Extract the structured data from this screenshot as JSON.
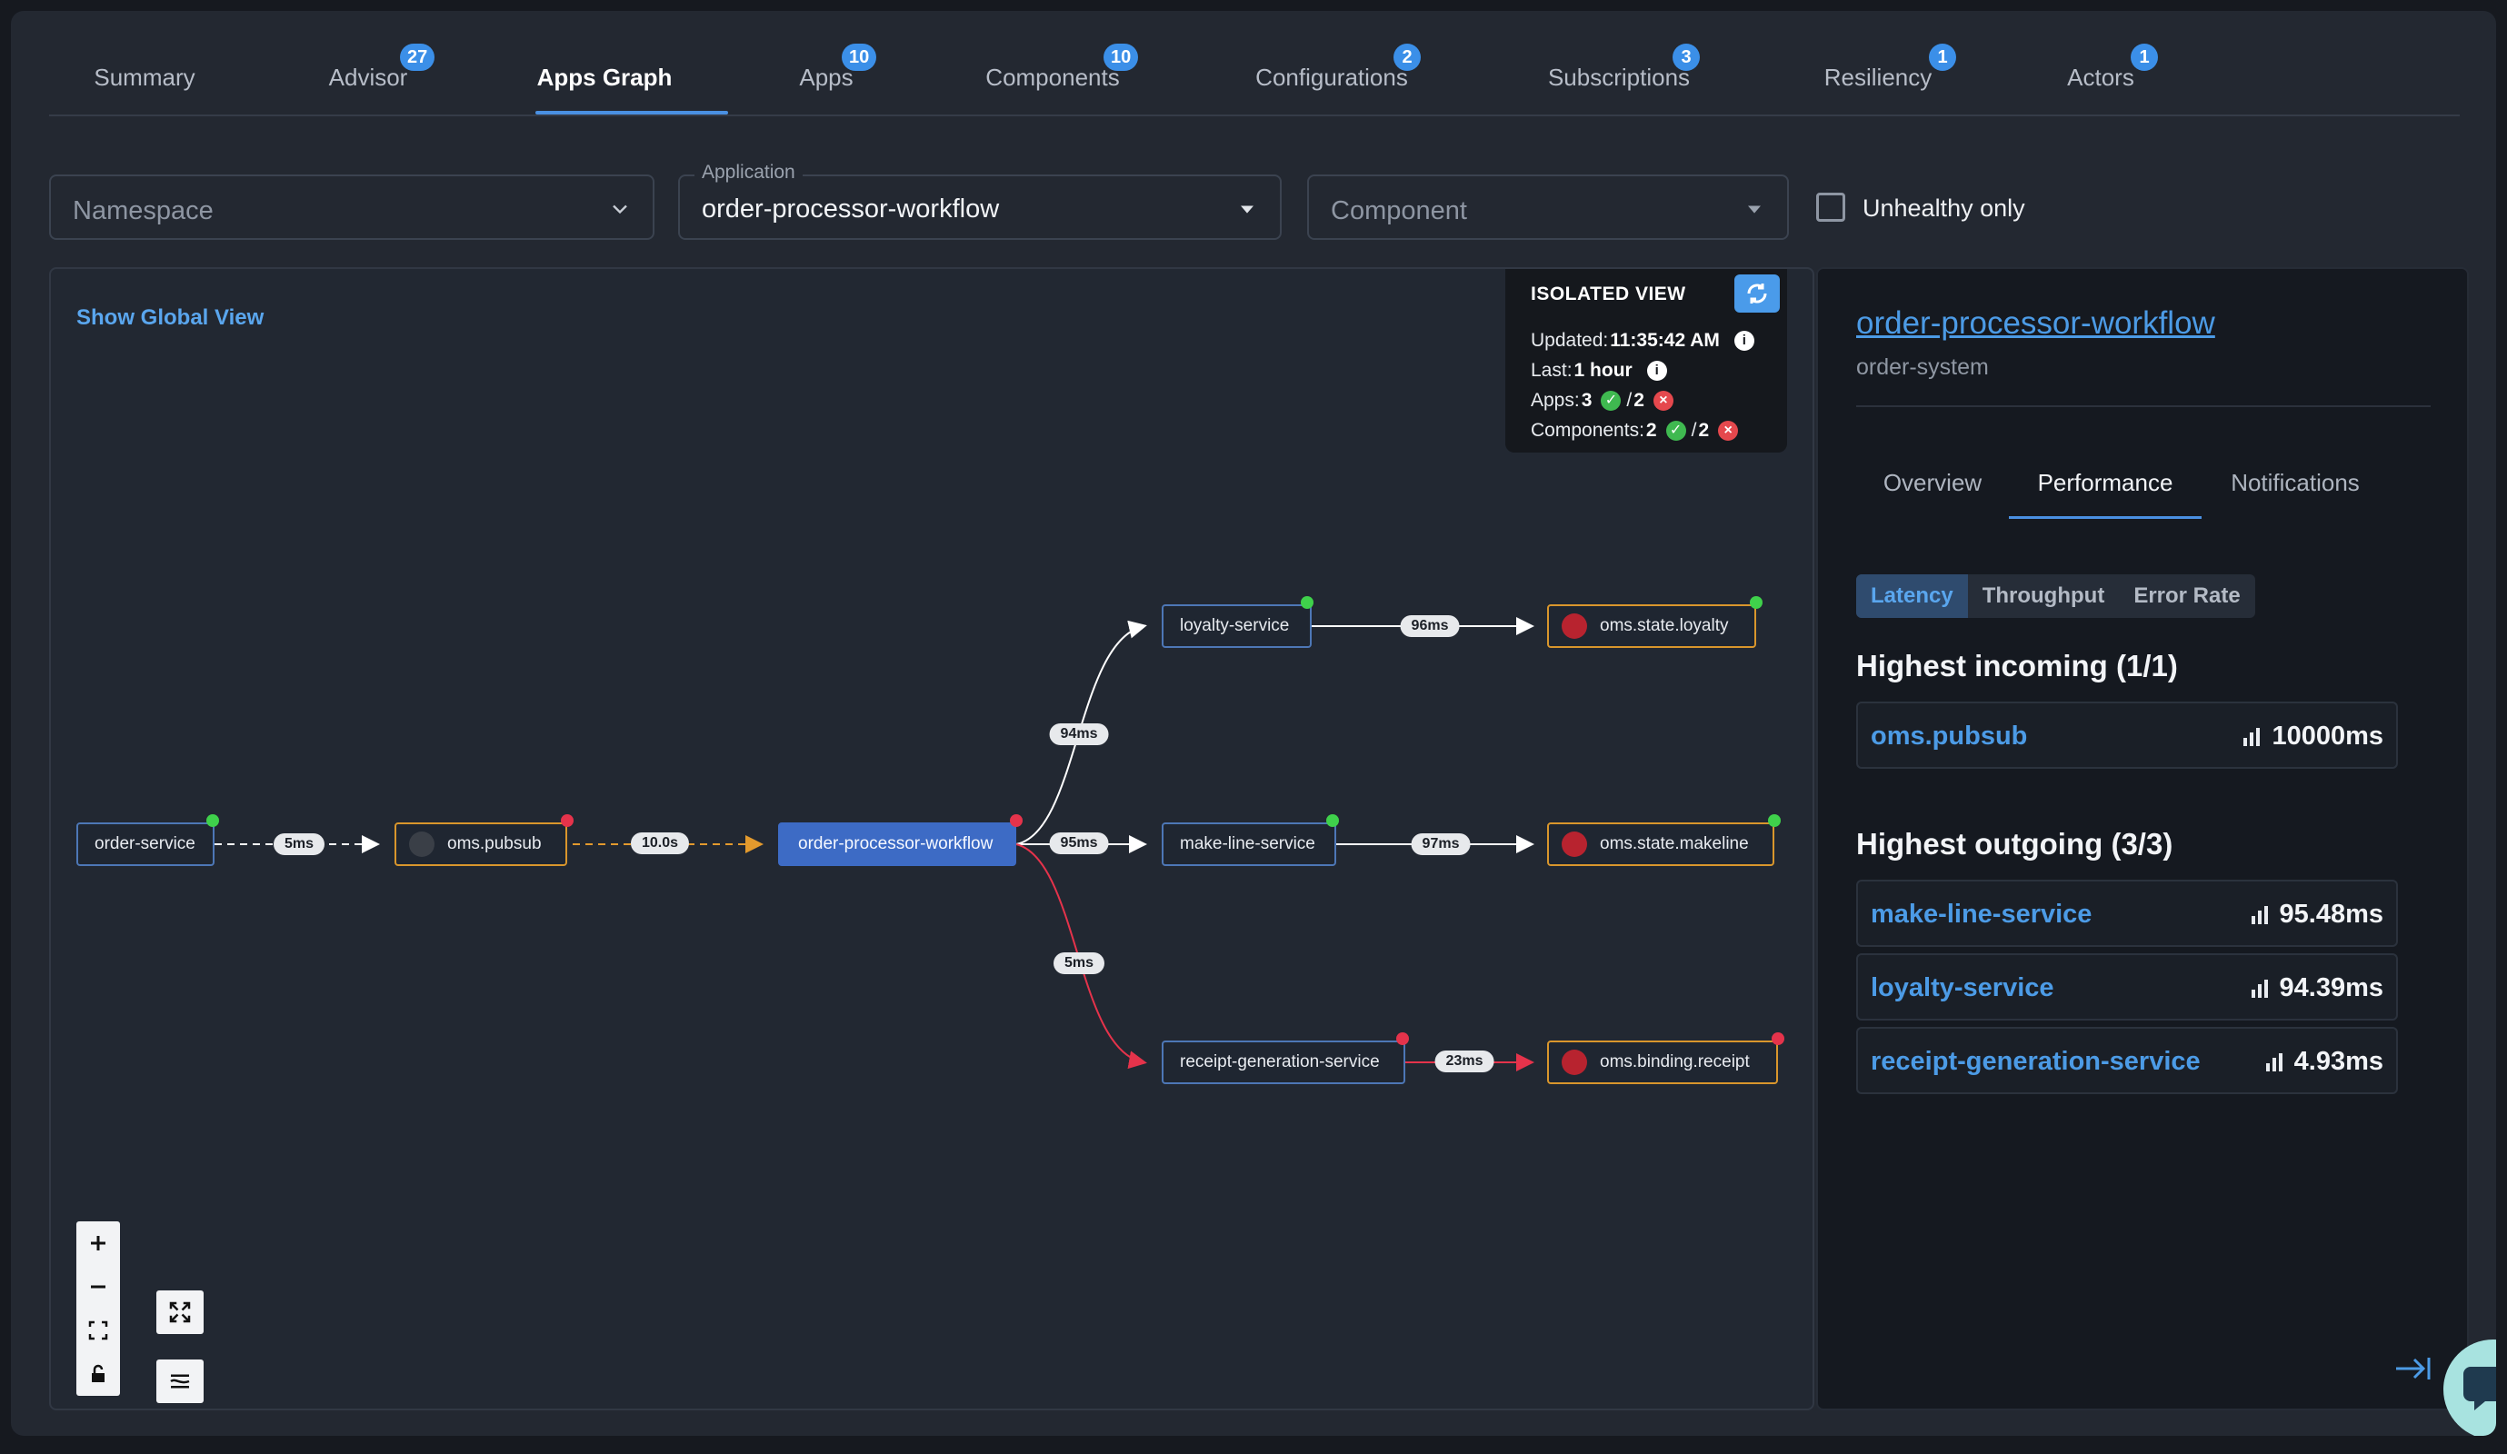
{
  "tabs": [
    {
      "label": "Summary",
      "badge": null
    },
    {
      "label": "Advisor",
      "badge": "27"
    },
    {
      "label": "Apps Graph",
      "badge": null
    },
    {
      "label": "Apps",
      "badge": "10"
    },
    {
      "label": "Components",
      "badge": "10"
    },
    {
      "label": "Configurations",
      "badge": "2"
    },
    {
      "label": "Subscriptions",
      "badge": "3"
    },
    {
      "label": "Resiliency",
      "badge": "1"
    },
    {
      "label": "Actors",
      "badge": "1"
    }
  ],
  "filters": {
    "namespace_placeholder": "Namespace",
    "application_label": "Application",
    "application_value": "order-processor-workflow",
    "component_placeholder": "Component",
    "unhealthy_label": "Unhealthy only"
  },
  "graph": {
    "global_link": "Show Global View",
    "isolated": {
      "title": "ISOLATED VIEW",
      "updated_label": "Updated:",
      "updated_value": "11:35:42 AM",
      "last_label": "Last:",
      "last_value": "1 hour",
      "apps_label": "Apps:",
      "apps_ok": "3",
      "apps_err": "2",
      "components_label": "Components:",
      "components_ok": "2",
      "components_err": "2",
      "separator": "/"
    },
    "nodes": {
      "order_service": "order-service",
      "oms_pubsub": "oms.pubsub",
      "workflow": "order-processor-workflow",
      "loyalty_service": "loyalty-service",
      "make_line_service": "make-line-service",
      "receipt_service": "receipt-generation-service",
      "state_loyalty": "oms.state.loyalty",
      "state_makeline": "oms.state.makeline",
      "binding_receipt": "oms.binding.receipt"
    },
    "edges": {
      "e1": "5ms",
      "e2": "10.0s",
      "e3": "94ms",
      "e4": "95ms",
      "e5": "5ms",
      "e6": "96ms",
      "e7": "97ms",
      "e8": "23ms"
    },
    "colors": {
      "healthy": "#3fd14b",
      "unhealthy": "#e5334b",
      "component_border": "#d9962c",
      "service_border": "#4d77b6"
    }
  },
  "side": {
    "title": "order-processor-workflow",
    "subtitle": "order-system",
    "tabs": [
      "Overview",
      "Performance",
      "Notifications"
    ],
    "segments": [
      "Latency",
      "Throughput",
      "Error Rate"
    ],
    "incoming_title": "Highest incoming (1/1)",
    "incoming": [
      {
        "name": "oms.pubsub",
        "value": "10000ms"
      }
    ],
    "outgoing_title": "Highest outgoing (3/3)",
    "outgoing": [
      {
        "name": "make-line-service",
        "value": "95.48ms"
      },
      {
        "name": "loyalty-service",
        "value": "94.39ms"
      },
      {
        "name": "receipt-generation-service",
        "value": "4.93ms"
      }
    ]
  }
}
